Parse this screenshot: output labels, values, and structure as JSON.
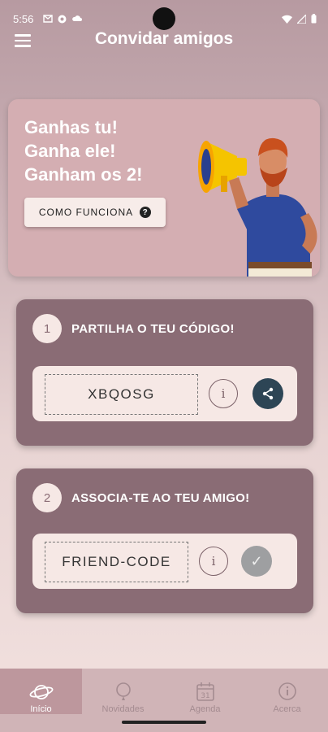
{
  "status_bar": {
    "time": "5:56",
    "icons": [
      "gmail-icon",
      "circle-icon",
      "cloud-icon"
    ],
    "right_icons": [
      "wifi-icon",
      "signal-icon",
      "battery-icon"
    ]
  },
  "header": {
    "title": "Convidar amigos",
    "menu_icon": "hamburger-icon"
  },
  "hero": {
    "line1": "Ganhas tu!",
    "line2": "Ganha ele!",
    "line3": "Ganham os 2!",
    "how_button": "COMO FUNCIONA",
    "how_icon": "?"
  },
  "step1": {
    "number": "1",
    "title": "PARTILHA O TEU CÓDIGO!",
    "code": "XBQOSG",
    "info_icon": "i"
  },
  "step2": {
    "number": "2",
    "title": "ASSOCIA-TE AO TEU AMIGO!",
    "code_placeholder": "FRIEND-CODE",
    "info_icon": "i",
    "check_icon": "✓"
  },
  "nav": {
    "items": [
      {
        "label": "Início",
        "icon": "planet-icon",
        "active": true
      },
      {
        "label": "Novidades",
        "icon": "bell-icon",
        "active": false
      },
      {
        "label": "Agenda",
        "icon": "calendar-icon",
        "day": "31",
        "active": false
      },
      {
        "label": "Acerca",
        "icon": "info-icon",
        "active": false
      }
    ]
  },
  "colors": {
    "card": "#8a6c75",
    "hero": "#d4aeb2",
    "share": "#2d4555",
    "check": "#9e9fa1",
    "nav_active": "#bd979d"
  }
}
